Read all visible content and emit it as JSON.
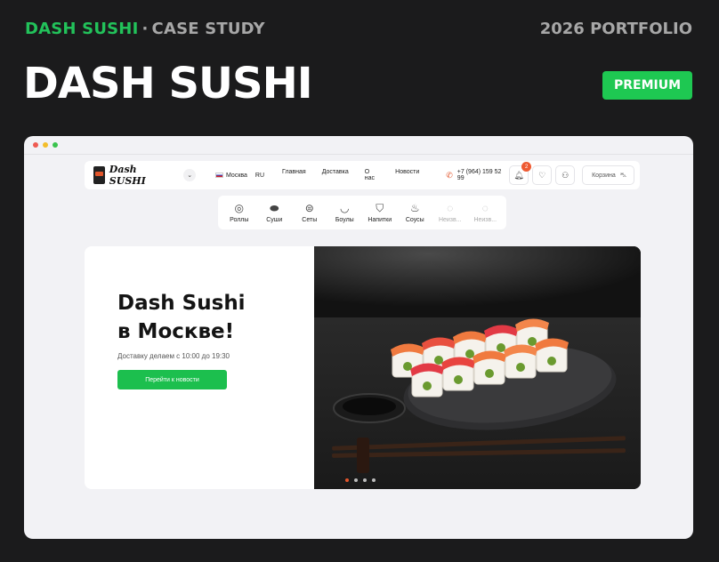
{
  "header": {
    "brand": "DASH SUSHI",
    "separator": "·",
    "subtitle": "CASE STUDY",
    "portfolio": "2026 PORTFOLIO",
    "title": "DASH SUSHI",
    "badge": "PREMIUM"
  },
  "colors": {
    "accent": "#22c25a",
    "background": "#1b1b1c",
    "orange": "#e2552b"
  },
  "site": {
    "logo_text": "Dash SUSHI",
    "city": "Москва",
    "lang": "RU",
    "nav": [
      "Главная",
      "Доставка",
      "О нас",
      "Новости"
    ],
    "phone": "+7 (964) 159 52 99",
    "notifications_count": "2",
    "cart_label": "Корзина",
    "categories": [
      {
        "label": "Роллы",
        "icon": "roll-icon"
      },
      {
        "label": "Суши",
        "icon": "sushi-icon"
      },
      {
        "label": "Сеты",
        "icon": "set-icon"
      },
      {
        "label": "Боулы",
        "icon": "bowl-icon"
      },
      {
        "label": "Напитки",
        "icon": "drink-icon"
      },
      {
        "label": "Соусы",
        "icon": "sauce-icon"
      },
      {
        "label": "Неизв...",
        "icon": "unknown-icon"
      },
      {
        "label": "Неизв...",
        "icon": "unknown-icon"
      }
    ],
    "hero": {
      "title": "Dash Sushi\nв Москве!",
      "subtitle": "Доставку делаем с 10:00 до 19:30",
      "button": "Перейти к новости",
      "slides_total": 4,
      "active_slide": 1
    }
  }
}
